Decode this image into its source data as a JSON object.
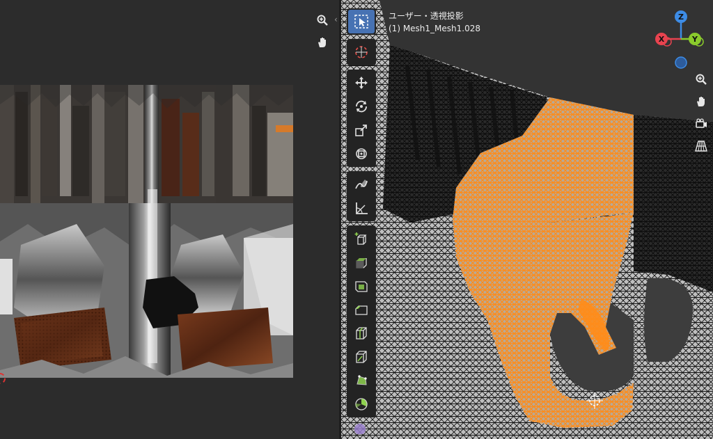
{
  "uv_editor": {
    "zoom_icon": "zoom-in-icon",
    "pan_icon": "hand-pan-icon",
    "collapse_arrow": "‹"
  },
  "viewport": {
    "view_title": "ユーザー・透視投影",
    "object_name": "(1) Mesh1_Mesh1.028",
    "colors": {
      "selection": "#ff8c1a",
      "wire": "#111111",
      "face": "#bdbdbd",
      "active_tool": "#4772b3"
    },
    "gizmo": {
      "x_label": "X",
      "y_label": "Y",
      "z_label": "Z",
      "x_color": "#e8434f",
      "y_color": "#8acb2c",
      "z_color": "#3d8ce6"
    },
    "tools": [
      "select-box-icon",
      "cursor-icon",
      "move-icon",
      "rotate-icon",
      "scale-icon",
      "transform-icon",
      "annotate-icon",
      "measure-icon",
      "add-cube-icon",
      "extrude-icon",
      "inset-icon",
      "bevel-icon",
      "loop-cut-icon",
      "knife-icon",
      "poly-build-icon",
      "spin-icon",
      "smooth-icon"
    ],
    "nav_icons": [
      "zoom-in-icon",
      "hand-pan-icon",
      "camera-icon",
      "perspective-grid-icon"
    ]
  }
}
